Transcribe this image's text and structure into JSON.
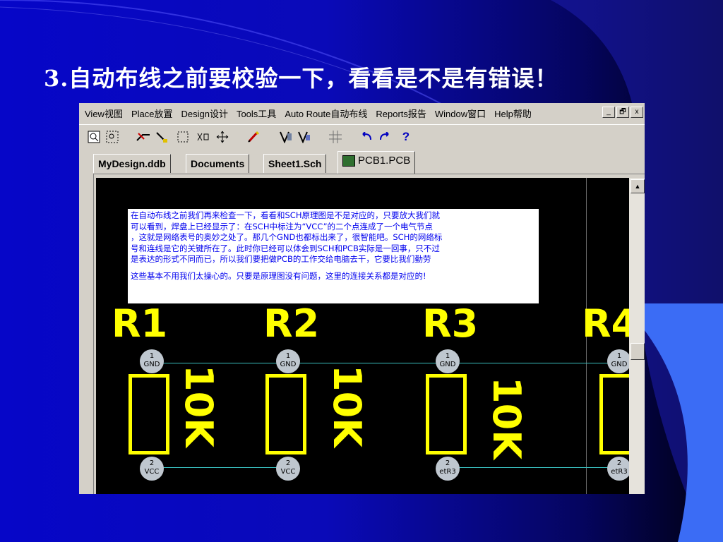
{
  "slide": {
    "title": "3.自动布线之前要校验一下，看看是不是有错误！",
    "colors": {
      "background": "#0a0ab8",
      "title": "#ffffff",
      "accent_shape": "#3b6cf5"
    }
  },
  "menu": {
    "items": [
      "View视图",
      "Place放置",
      "Design设计",
      "Tools工具",
      "Auto Route自动布线",
      "Reports报告",
      "Window窗口",
      "Help帮助"
    ],
    "window_buttons": [
      "_",
      "🗗",
      "x"
    ]
  },
  "toolbar": {
    "icons": [
      "zoom-fit-icon",
      "zoom-area-icon",
      "route-icon",
      "wire-icon",
      "select-rect-icon",
      "cross-probe-icon",
      "move-icon",
      "pencil-icon",
      "library-icon",
      "browse-icon",
      "grid-icon",
      "undo-icon",
      "redo-icon",
      "help-icon"
    ],
    "help_label": "?"
  },
  "tabs": {
    "items": [
      "MyDesign.ddb",
      "Documents",
      "Sheet1.Sch",
      "PCB1.PCB"
    ],
    "active": "PCB1.PCB"
  },
  "note": {
    "lines": [
      "在自动布线之前我们再来检查一下，看看和SCH原理图是不是对应的，只要放大我们就",
      "可以看到，焊盘上已经显示了：在SCH中标注为“VCC”的二个点连成了一个电气节点",
      "，这就是网络表号的奥妙之处了。那几个GND也都标出来了，很智能吧。SCH的网络标",
      "号和连线是它的关键所在了。此时你已经可以体会到SCH和PCB实际是一回事，只不过",
      "是表达的形式不同而已，所以我们要把做PCB的工作交给电脑去干，它要比我们勤劳"
    ],
    "last_line": "这些基本不用我们太操心的。只要是原理图没有问题，这里的连接关系都是对应的!"
  },
  "pcb": {
    "colors": {
      "silkscreen": "#ffff00",
      "pad": "#bfc7cf",
      "netline": "#3ac0c0",
      "board": "#000000"
    },
    "components": [
      {
        "designator": "R1",
        "value": "10K",
        "pad1_num": "1",
        "pad1_net": "GND",
        "pad2_num": "2",
        "pad2_net": "VCC"
      },
      {
        "designator": "R2",
        "value": "10K",
        "pad1_num": "1",
        "pad1_net": "GND",
        "pad2_num": "2",
        "pad2_net": "VCC"
      },
      {
        "designator": "R3",
        "value": "10K",
        "pad1_num": "1",
        "pad1_net": "GND",
        "pad2_num": "2",
        "pad2_net": "etR3"
      },
      {
        "designator": "R4",
        "value": "",
        "pad1_num": "1",
        "pad1_net": "GND",
        "pad2_num": "2",
        "pad2_net": "etR3"
      }
    ]
  }
}
